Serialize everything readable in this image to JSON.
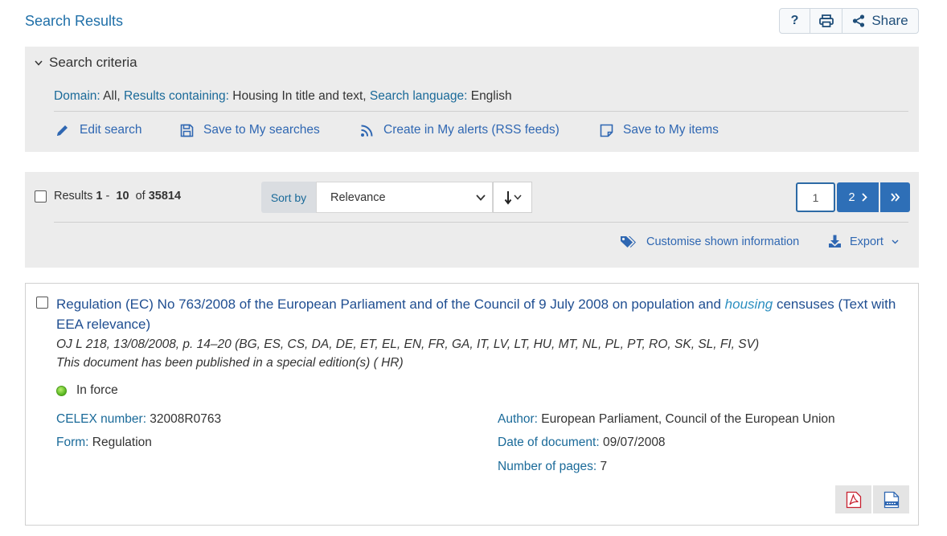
{
  "header": {
    "title": "Search Results",
    "help_icon": "question-icon",
    "share_label": "Share"
  },
  "criteria": {
    "heading": "Search criteria",
    "domain_label": "Domain:",
    "domain_value": " All,",
    "containing_label": "Results containing:",
    "containing_value": " Housing In title and text,",
    "language_label": "Search language:",
    "language_value": " English",
    "actions": {
      "edit": "Edit search",
      "save_search": "Save to My searches",
      "alerts": "Create in My alerts (RSS feeds)",
      "save_items": "Save to My items"
    }
  },
  "results_bar": {
    "results_label": "Results",
    "from": "1",
    "dash": "-",
    "to": "10",
    "of_label": "of",
    "total": "35814",
    "sort_label": "Sort by",
    "sort_value": "Relevance",
    "page_current": "1",
    "page_next": "2",
    "customise_label": "Customise shown information",
    "export_label": "Export"
  },
  "result": {
    "title_before": "Regulation (EC) No 763/2008 of the European Parliament and of the Council of 9 July 2008 on population and ",
    "title_highlight": "housing",
    "title_after": " censuses (Text with EEA relevance)",
    "oj_ref": "OJ L 218, 13/08/2008, p. 14–20 (BG, ES, CS, DA, DE, ET, EL, EN, FR, GA, IT, LV, LT, HU, MT, NL, PL, PT, RO, SK, SL, FI, SV)",
    "special_edition": "This document has been published in a special edition(s) ( HR)",
    "status": "In force",
    "celex_label": "CELEX number:",
    "celex_value": " 32008R0763",
    "form_label": "Form:",
    "form_value": " Regulation",
    "author_label": "Author:",
    "author_value": " European Parliament, Council of the European Union",
    "date_label": "Date of document:",
    "date_value": " 09/07/2008",
    "pages_label": "Number of pages:",
    "pages_value": " 7"
  },
  "colors": {
    "accent": "#2e6fb7",
    "label_blue": "#1a6a99",
    "panel_bg": "#ececec",
    "status_green": "#54b31d"
  }
}
